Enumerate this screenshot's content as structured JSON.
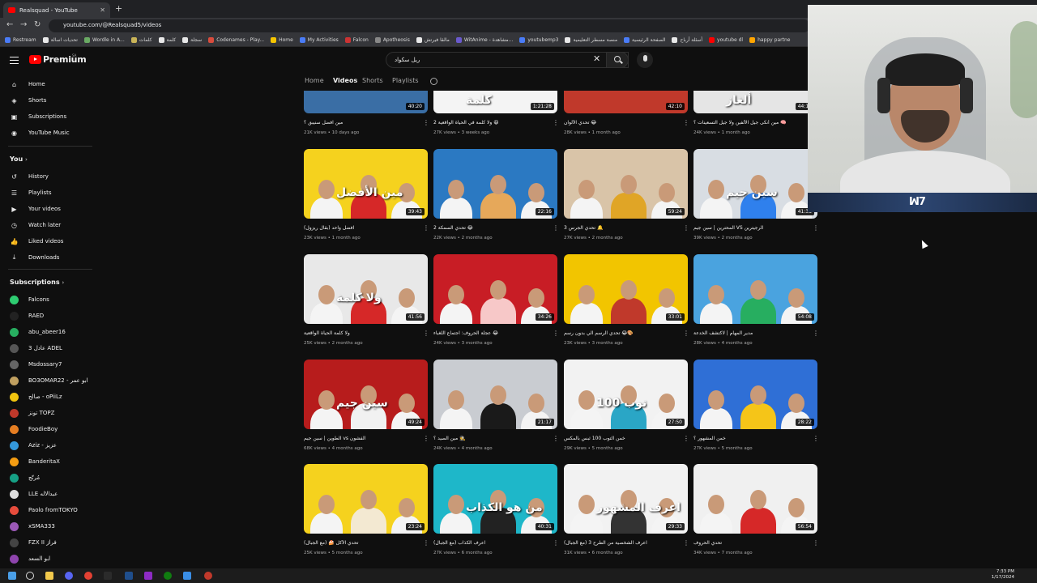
{
  "browser": {
    "tab_title": "Realsquad - YouTube",
    "new_tab": "+",
    "url": "youtube.com/@Realsquad5/videos",
    "bookmarks": [
      {
        "label": "Restream",
        "color": "#4a7cf7"
      },
      {
        "label": "تحديات اسالة",
        "color": "#e8e8e8"
      },
      {
        "label": "Wordle in A...",
        "color": "#6aaa64"
      },
      {
        "label": "كلمات",
        "color": "#c9b458"
      },
      {
        "label": "كلمة",
        "color": "#e8e8e8"
      },
      {
        "label": "سجلة",
        "color": "#e8e8e8"
      },
      {
        "label": "Codenames - Play...",
        "color": "#d94c3d"
      },
      {
        "label": "Home",
        "color": "#f6c500"
      },
      {
        "label": "My Activities",
        "color": "#4a7cf7"
      },
      {
        "label": "Falcon",
        "color": "#c33"
      },
      {
        "label": "Apotheosis",
        "color": "#888"
      },
      {
        "label": "مالقا فيرتش",
        "color": "#e8e8e8"
      },
      {
        "label": "WitAnime - مشاهدة...",
        "color": "#6a5acd"
      },
      {
        "label": "youtubemp3",
        "color": "#4a7cf7"
      },
      {
        "label": "منصة مسطر التعليمية",
        "color": "#e8e8e8"
      },
      {
        "label": "الصفحة الرئيسية",
        "color": "#4a7cf7"
      },
      {
        "label": "أسئلة أرباح",
        "color": "#e8e8e8"
      },
      {
        "label": "youtube dl",
        "color": "#ff0000"
      },
      {
        "label": "happy partne",
        "color": "#ffa500"
      }
    ]
  },
  "youtube": {
    "logo_text": "Premium",
    "region": "SA",
    "search_value": "ريل سكواد",
    "sidebar": {
      "main": [
        {
          "label": "Home",
          "icon": "home-icon"
        },
        {
          "label": "Shorts",
          "icon": "shorts-icon"
        },
        {
          "label": "Subscriptions",
          "icon": "subscriptions-icon"
        },
        {
          "label": "YouTube Music",
          "icon": "youtube-music-icon"
        }
      ],
      "you_heading": "You",
      "you": [
        {
          "label": "History",
          "icon": "history-icon"
        },
        {
          "label": "Playlists",
          "icon": "playlists-icon"
        },
        {
          "label": "Your videos",
          "icon": "your-videos-icon"
        },
        {
          "label": "Watch later",
          "icon": "watch-later-icon"
        },
        {
          "label": "Liked videos",
          "icon": "liked-videos-icon"
        },
        {
          "label": "Downloads",
          "icon": "downloads-icon"
        }
      ],
      "subs_heading": "Subscriptions",
      "subscriptions": [
        {
          "label": "Falcons",
          "color": "#2ecc71"
        },
        {
          "label": "RAED",
          "color": "#222"
        },
        {
          "label": "abu_abeer16",
          "color": "#27ae60"
        },
        {
          "label": "3 عادل ADEL",
          "color": "#555"
        },
        {
          "label": "Msdossary7",
          "color": "#666"
        },
        {
          "label": "BO3OMAR22 - ابو عمر",
          "color": "#c0a060"
        },
        {
          "label": "صالح - oPiiLz",
          "color": "#f1c40f"
        },
        {
          "label": "تونز TOPZ",
          "color": "#c0392b"
        },
        {
          "label": "FoodieBoy",
          "color": "#e67e22"
        },
        {
          "label": "Aziz - عزيز",
          "color": "#3498db"
        },
        {
          "label": "BanderitaX",
          "color": "#f39c12"
        },
        {
          "label": "مُرتّج",
          "color": "#16a085"
        },
        {
          "label": "LLE عبدالاله",
          "color": "#ddd"
        },
        {
          "label": "Paolo fromTOKYO",
          "color": "#e74c3c"
        },
        {
          "label": "xSMA333",
          "color": "#9b59b6"
        },
        {
          "label": "FZX II فراز",
          "color": "#444"
        },
        {
          "label": "ابو السعد",
          "color": "#8e44ad"
        }
      ]
    },
    "channel_tabs": [
      "Home",
      "Videos",
      "Shorts",
      "Playlists"
    ],
    "active_tab": "Videos",
    "videos": [
      {
        "title": "مين افضل سنيبق ؟",
        "meta": "21K views • 10 days ago",
        "duration": "40:20",
        "bg": "#3a6ea5",
        "accent": "#e8e8e8",
        "text": ""
      },
      {
        "title": "ولا كلمة في الحياة الواقعية 2 😆",
        "meta": "27K views • 3 weeks ago",
        "duration": "1:21:28",
        "bg": "#f4f4f4",
        "accent": "#d62828",
        "text": "كلمة"
      },
      {
        "title": "تحدي الألوان 😂",
        "meta": "28K views • 1 month ago",
        "duration": "42:10",
        "bg": "#c0392b",
        "accent": "#f1c40f",
        "text": ""
      },
      {
        "title": "مين أنكى جيل الألفين ولا جيل التسعينات ؟ 🧠",
        "meta": "24K views • 1 month ago",
        "duration": "44:14",
        "bg": "#e5e5e5",
        "accent": "#777",
        "text": "ألغاز"
      },
      {
        "title": "افضل واحد (بقال ريزول)",
        "meta": "23K views • 1 month ago",
        "duration": "39:43",
        "bg": "#f5d21e",
        "accent": "#d62828",
        "text": "مين الأفضل"
      },
      {
        "title": "تحدي السمكة 2 😂",
        "meta": "22K views • 2 months ago",
        "duration": "22:16",
        "bg": "#2b79c2",
        "accent": "#e6a85a",
        "text": ""
      },
      {
        "title": "تحدي الجرس 3 🔔",
        "meta": "27K views • 2 months ago",
        "duration": "59:24",
        "bg": "#d9c4a8",
        "accent": "#e0a526",
        "text": ""
      },
      {
        "title": "المحترين | سين جيم VS الرجيترين",
        "meta": "39K views • 2 months ago",
        "duration": "41:38",
        "bg": "#d8dde3",
        "accent": "#2f80ed",
        "text": "سين جيم"
      },
      {
        "title": "ولا كلمة الحياة الواقعية",
        "meta": "25K views • 2 months ago",
        "duration": "41:56",
        "bg": "#e8e8e8",
        "accent": "#d62828",
        "text": "ولا كلمة"
      },
      {
        "title": "عجلة الحروف: اجتماع اللغباء 😂",
        "meta": "24K views • 3 months ago",
        "duration": "34:26",
        "bg": "#c81d25",
        "accent": "#f7c8c8",
        "text": ""
      },
      {
        "title": "تحدي الرسم الي بدون رسم 😂🎨",
        "meta": "23K views • 3 months ago",
        "duration": "33:01",
        "bg": "#f2c500",
        "accent": "#c0392b",
        "text": ""
      },
      {
        "title": "مدير المهام | لاكتشف الخدعة",
        "meta": "28K views • 4 months ago",
        "duration": "54:08",
        "bg": "#4aa3df",
        "accent": "#27ae60",
        "text": ""
      },
      {
        "title": "الطوين | سين جيم vs الفشون",
        "meta": "68K views • 4 months ago",
        "duration": "49:24",
        "bg": "#b71c1c",
        "accent": "#f1f1f1",
        "text": "سين جيم"
      },
      {
        "title": "مين الصيد ؟ 🕵️",
        "meta": "24K views • 4 months ago",
        "duration": "21:17",
        "bg": "#c9ccd1",
        "accent": "#1a1a1a",
        "text": ""
      },
      {
        "title": "خمن التوب 100 ثبس بالمكس",
        "meta": "29K views • 5 months ago",
        "duration": "27:50",
        "bg": "#f2f2f2",
        "accent": "#2aa6c6",
        "text": "توب 100"
      },
      {
        "title": "خمن المشهور ؟",
        "meta": "27K views • 5 months ago",
        "duration": "28:22",
        "bg": "#2f6fd6",
        "accent": "#f5c518",
        "text": ""
      },
      {
        "title": "تحدي الأكل 🍰 (مع الجبال)",
        "meta": "25K views • 5 months ago",
        "duration": "23:24",
        "bg": "#f5d21e",
        "accent": "#f3e9d2",
        "text": ""
      },
      {
        "title": "اعرف الكذاب (مع الجبال)",
        "meta": "27K views • 6 months ago",
        "duration": "40:31",
        "bg": "#1eb7c9",
        "accent": "#222",
        "text": "من هو الكذاب"
      },
      {
        "title": "اعرف الشخصية من الطرح 3 (مع الجبال)",
        "meta": "31K views • 6 months ago",
        "duration": "29:33",
        "bg": "#f2f2f2",
        "accent": "#333",
        "text": "اعرف المشهور"
      },
      {
        "title": "تحدي الحروف",
        "meta": "34K views • 7 months ago",
        "duration": "56:54",
        "bg": "#f0f0f0",
        "accent": "#d62828",
        "text": ""
      }
    ]
  },
  "webcam": {
    "logo": "ꟽ7"
  },
  "taskbar": {
    "time": "7:33 PM",
    "date": "1/17/2024"
  }
}
